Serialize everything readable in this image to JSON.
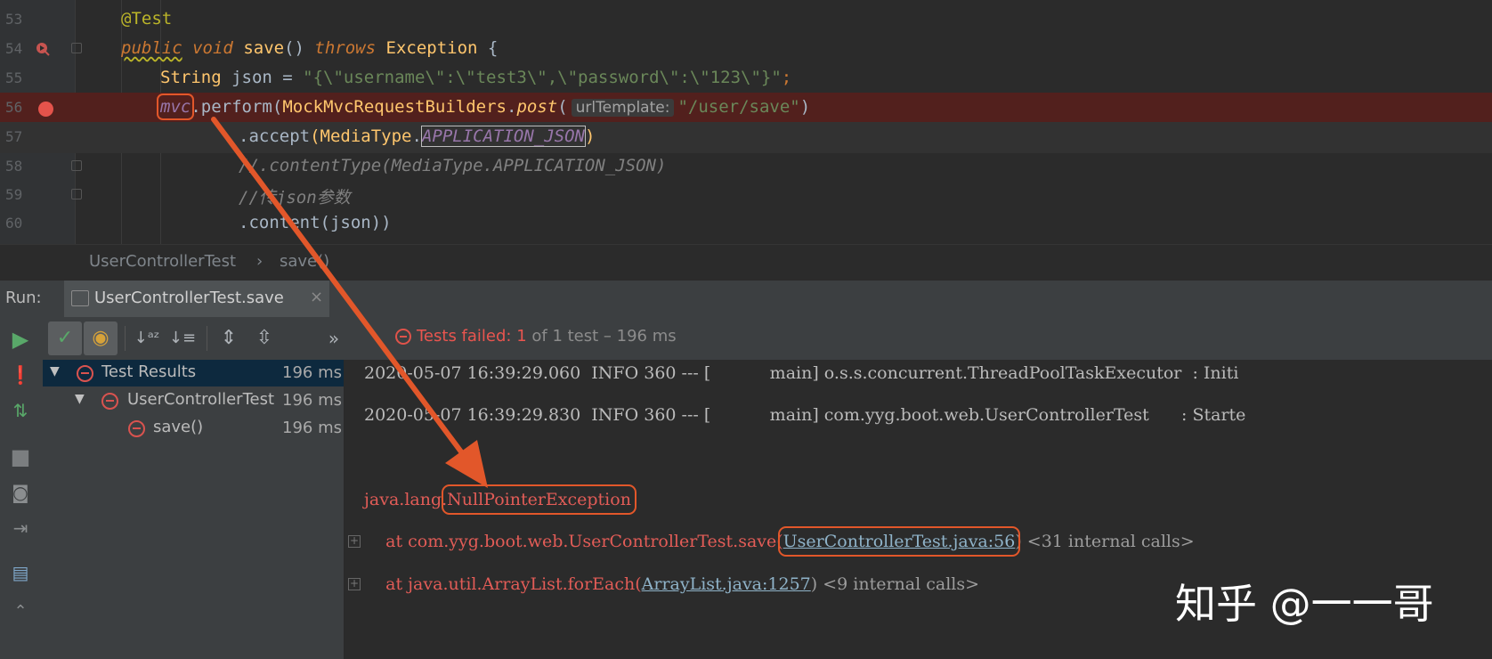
{
  "editor": {
    "lines": [
      {
        "num": "53"
      },
      {
        "num": "54"
      },
      {
        "num": "55"
      },
      {
        "num": "56"
      },
      {
        "num": "57"
      },
      {
        "num": "58"
      },
      {
        "num": "59"
      },
      {
        "num": "60"
      }
    ],
    "l53": {
      "ann": "@Test"
    },
    "l54": {
      "kw1": "public",
      "kw2": "void",
      "fn": "save",
      "parens": "()",
      "kw3": "throws",
      "exc": "Exception",
      "brace": "{"
    },
    "l55": {
      "type": "String",
      "rest": " json = ",
      "str": "\"{\\\"username\\\":\\\"test3\\\",\\\"password\\\":\\\"123\\\"}\"",
      "end": ";"
    },
    "l56": {
      "var": "mvc",
      "dot": ".",
      "m1": "perform",
      "p1": "(",
      "cls": "MockMvcRequestBuilders",
      "dot2": ".",
      "m2": "post",
      "p2": "(",
      "hint": "urlTemplate:",
      "str": "\"/user/save\"",
      "p3": ")"
    },
    "l57": {
      "dot": ".",
      "m": "accept",
      "p1": "(",
      "cls": "MediaType",
      "dot2": ".",
      "fld": "APPLICATION_JSON",
      "p2": ")"
    },
    "l58": {
      "cmt": "//.contentType(MediaType.APPLICATION_JSON)"
    },
    "l59": {
      "cmt": "//传json参数"
    },
    "l60": {
      "dot": ".",
      "m": "content",
      "rest": "(json))"
    }
  },
  "breadcrumb": {
    "cls": "UserControllerTest",
    "sep": "›",
    "method": "save()"
  },
  "run": {
    "label": "Run:",
    "tab_title": "UserControllerTest.save",
    "tab_close": "×",
    "more": "»",
    "status_prefix": "Tests failed: ",
    "failed_count": "1",
    "status_suffix": " of 1 test",
    "status_time": " – 196 ms"
  },
  "tree": {
    "items": [
      {
        "name": "Test Results",
        "time": "196 ms"
      },
      {
        "name": "UserControllerTest",
        "time": "196 ms"
      },
      {
        "name": "save()",
        "time": "196 ms"
      }
    ],
    "arrow": "▼"
  },
  "console": {
    "log1": "2020-05-07 16:39:29.060  INFO 360 --- [           main] o.s.s.concurrent.ThreadPoolTaskExecutor  : Initi",
    "log2": "2020-05-07 16:39:29.830  INFO 360 --- [           main] com.yyg.boot.web.UserControllerTest      : Starte",
    "exc_pkg": "java.lang.",
    "exc_name": "NullPointerException",
    "at1_prefix": "    at com.yyg.boot.web.UserControllerTest.save(",
    "at1_link": "UserControllerTest.java:56",
    "at1_suffix": ") <31 internal calls>",
    "at2_prefix": "    at java.util.ArrayList.forEach(",
    "at2_link": "ArrayList.java:1257",
    "at2_suffix": ") <9 internal calls>",
    "plus": "+"
  },
  "watermark": "知乎 @一一哥",
  "colors": {
    "accent_red": "#e2572a",
    "breakpoint": "#e4534b",
    "error_text": "#e25c57"
  }
}
